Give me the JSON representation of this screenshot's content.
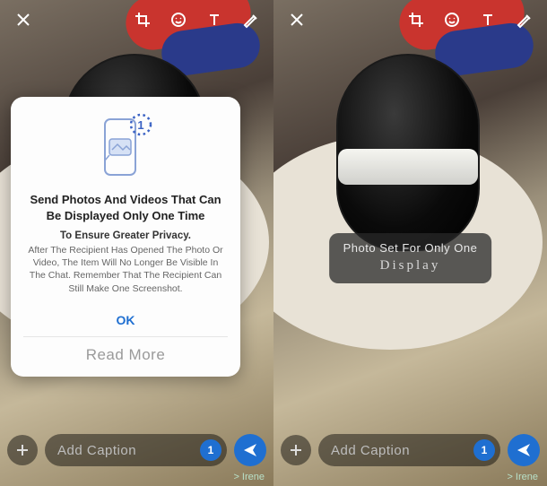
{
  "icons": {
    "close": "close-icon",
    "crop": "crop-icon",
    "emoji": "emoji-icon",
    "text": "text-icon",
    "draw": "draw-icon",
    "add": "add-icon",
    "send": "send-icon",
    "once": "once-badge"
  },
  "left": {
    "caption_placeholder": "Add Caption",
    "once_badge": "1",
    "recipient": "> Irene",
    "dialog": {
      "title": "Send Photos And Videos That Can Be Displayed Only One Time",
      "subtitle": "To Ensure Greater Privacy.",
      "body": "After The Recipient Has Opened The Photo Or Video, The Item Will No Longer Be Visible In The Chat. Remember That The Recipient Can Still Make One Screenshot.",
      "ok": "OK",
      "read_more": "Read More",
      "illus_badge": "1"
    }
  },
  "right": {
    "caption_placeholder": "Add Caption",
    "once_badge": "1",
    "recipient": "> Irene",
    "toast_line1": "Photo Set For Only One",
    "toast_line2": "Display"
  }
}
